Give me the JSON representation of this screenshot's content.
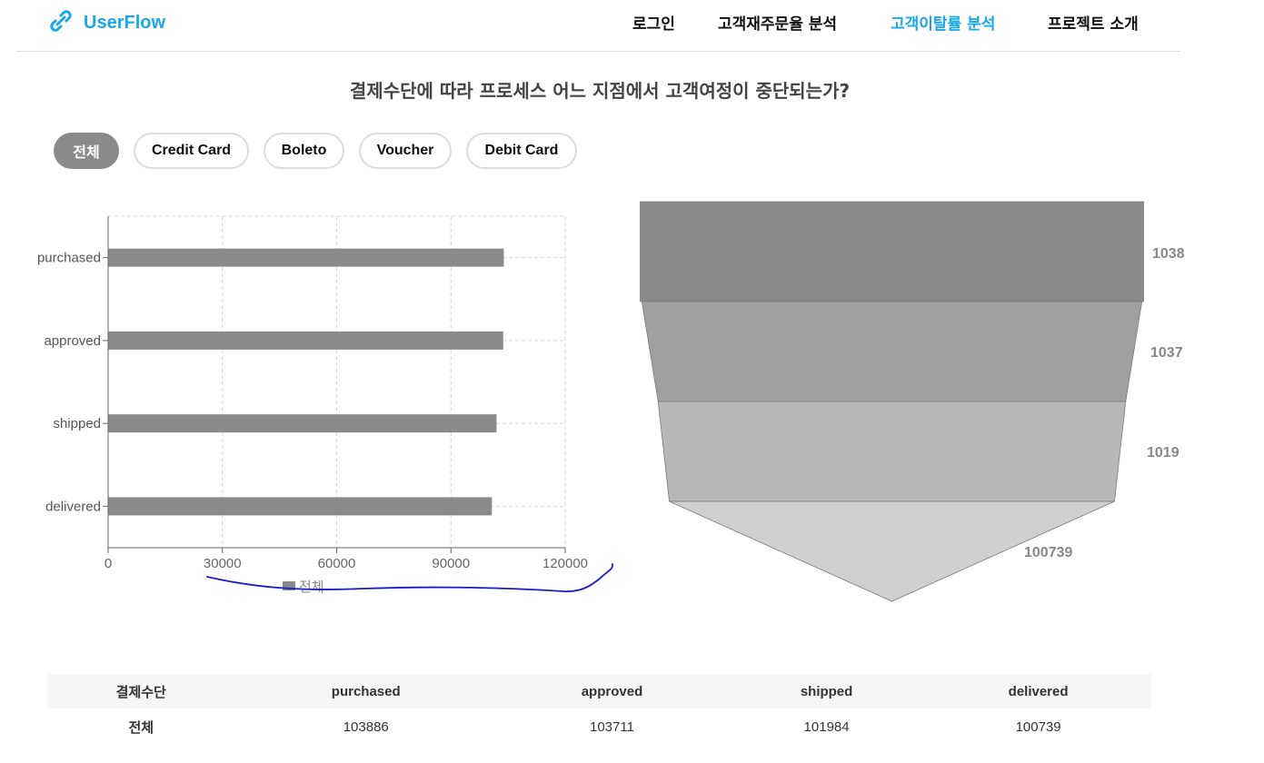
{
  "brand": {
    "name": "UserFlow",
    "color": "#1aa7e8",
    "icon": "link-logo-icon"
  },
  "nav": [
    {
      "label": "로그인",
      "active": false
    },
    {
      "label": "고객재주문율 분석",
      "active": false
    },
    {
      "label": "고객이탈률 분석",
      "active": true
    },
    {
      "label": "프로젝트 소개",
      "active": false
    }
  ],
  "page_title": "결제수단에 따라 프로세스 어느 지점에서 고객여정이 중단되는가?",
  "filters": [
    {
      "label": "전체",
      "active": true
    },
    {
      "label": "Credit Card",
      "active": false
    },
    {
      "label": "Boleto",
      "active": false
    },
    {
      "label": "Voucher",
      "active": false
    },
    {
      "label": "Debit Card",
      "active": false
    }
  ],
  "chart_data": [
    {
      "type": "bar",
      "orientation": "horizontal",
      "categories": [
        "purchased",
        "approved",
        "shipped",
        "delivered"
      ],
      "series": [
        {
          "name": "전체",
          "values": [
            103886,
            103711,
            101984,
            100739
          ],
          "color": "#8a8a8a"
        }
      ],
      "xlim": [
        0,
        120000
      ],
      "xticks": [
        0,
        30000,
        60000,
        90000,
        120000
      ],
      "grid": true,
      "legend": "bottom"
    },
    {
      "type": "funnel",
      "categories": [
        "purchased",
        "approved",
        "shipped",
        "delivered"
      ],
      "values": [
        103886,
        103711,
        101984,
        100739
      ],
      "labels": [
        "1038",
        "1037",
        "1019",
        "100739"
      ],
      "colors": [
        "#8a8a8a",
        "#a0a0a0",
        "#b8b8b8",
        "#d0d0d0"
      ]
    }
  ],
  "table": {
    "headers": [
      "결제수단",
      "purchased",
      "approved",
      "shipped",
      "delivered"
    ],
    "rows": [
      [
        "전체",
        "103886",
        "103711",
        "101984",
        "100739"
      ]
    ]
  },
  "annotation": {
    "type": "hand-drawn underline",
    "color": "#1a1acc"
  }
}
